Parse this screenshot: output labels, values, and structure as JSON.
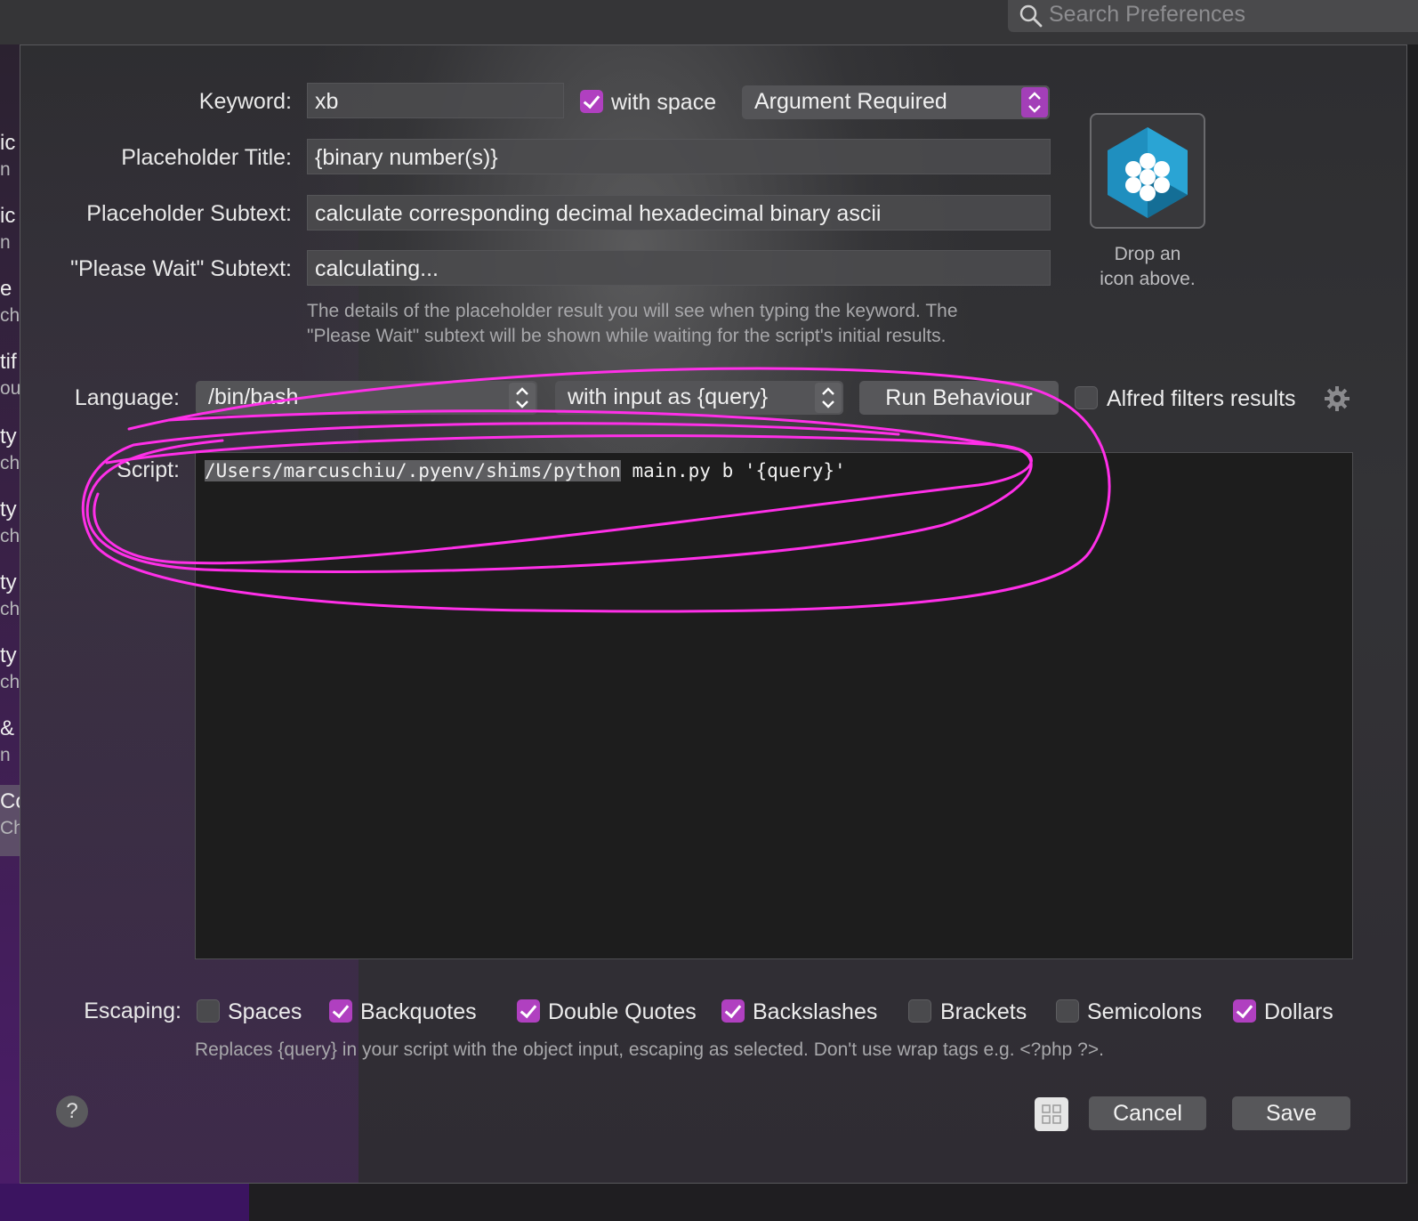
{
  "search": {
    "placeholder": "Search Preferences"
  },
  "sidebar": {
    "items": [
      {
        "title": "ic",
        "sub": "n"
      },
      {
        "title": "ic",
        "sub": "n"
      },
      {
        "title": "e",
        "sub": "chi"
      },
      {
        "title": "tif",
        "sub": "ou"
      },
      {
        "title": "ty",
        "sub": "ch"
      },
      {
        "title": "ty",
        "sub": "ch"
      },
      {
        "title": "ty",
        "sub": "ch"
      },
      {
        "title": "ty",
        "sub": "ch"
      },
      {
        "title": "&",
        "sub": "n"
      },
      {
        "title": "Co",
        "sub": "Ch"
      }
    ]
  },
  "form": {
    "keyword_label": "Keyword:",
    "keyword_value": "xb",
    "with_space_label": "with space",
    "with_space_checked": true,
    "argument_mode": "Argument Required",
    "placeholder_title_label": "Placeholder Title:",
    "placeholder_title_value": "{binary number(s)}",
    "placeholder_subtext_label": "Placeholder Subtext:",
    "placeholder_subtext_value": "calculate corresponding decimal hexadecimal binary ascii",
    "please_wait_label": "\"Please Wait\" Subtext:",
    "please_wait_value": "calculating...",
    "help_line1": "The details of the placeholder result you will see when typing the keyword. The",
    "help_line2": "\"Please Wait\" subtext will be shown while waiting for the script's initial results."
  },
  "icon_well": {
    "line1": "Drop an",
    "line2": "icon above.",
    "icon": "hexagon-honeycomb-icon"
  },
  "script": {
    "language_label": "Language:",
    "language_value": "/bin/bash",
    "input_mode": "with input as {query}",
    "run_behaviour_label": "Run Behaviour",
    "alfred_filters_label": "Alfred filters results",
    "alfred_filters_checked": false,
    "script_label": "Script:",
    "code_highlighted": "/Users/marcuschiu/.pyenv/shims/python",
    "code_rest": " main.py b '{query}'"
  },
  "escaping": {
    "label": "Escaping:",
    "options": [
      {
        "label": "Spaces",
        "checked": false
      },
      {
        "label": "Backquotes",
        "checked": true
      },
      {
        "label": "Double Quotes",
        "checked": true
      },
      {
        "label": "Backslashes",
        "checked": true
      },
      {
        "label": "Brackets",
        "checked": false
      },
      {
        "label": "Semicolons",
        "checked": false
      },
      {
        "label": "Dollars",
        "checked": true
      }
    ],
    "help": "Replaces {query} in your script with the object input, escaping as selected. Don't use wrap tags e.g. <?php ?>."
  },
  "footer": {
    "help_label": "?",
    "cancel_label": "Cancel",
    "save_label": "Save"
  },
  "colors": {
    "accent": "#b040c0",
    "annotation": "#ff2fe8"
  }
}
